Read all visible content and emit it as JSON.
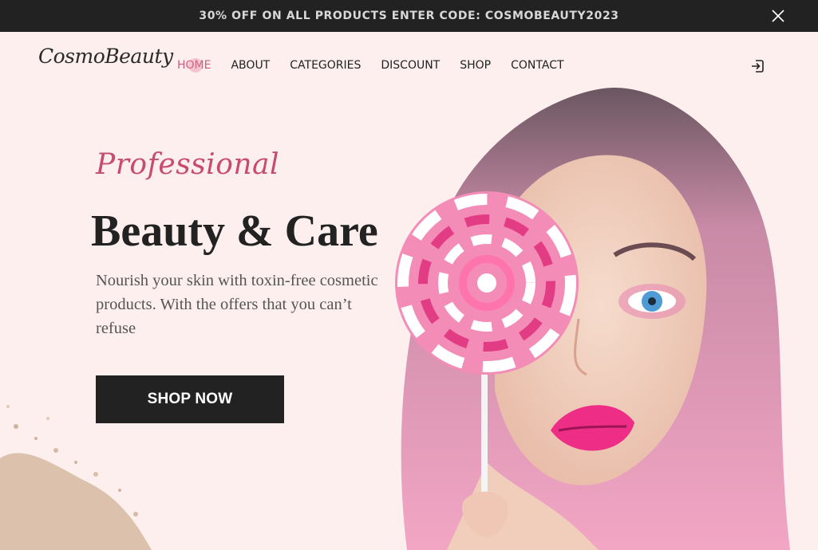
{
  "promo": {
    "text": "30% OFF ON ALL PRODUCTS ENTER CODE: COSMOBEAUTY2023",
    "close_icon": "close-icon"
  },
  "header": {
    "logo": "CosmoBeauty",
    "nav": [
      {
        "label": "HOME",
        "active": true
      },
      {
        "label": "ABOUT",
        "active": false
      },
      {
        "label": "CATEGORIES",
        "active": false
      },
      {
        "label": "DISCOUNT",
        "active": false
      },
      {
        "label": "SHOP",
        "active": false
      },
      {
        "label": "CONTACT",
        "active": false
      }
    ],
    "login_icon": "login-icon"
  },
  "hero": {
    "kicker": "Professional",
    "title": "Beauty & Care",
    "description": "Nourish your skin with toxin-free cosmetic products. With the offers that you can’t refuse",
    "cta": "SHOP NOW"
  },
  "colors": {
    "background": "#fcefee",
    "accent": "#c94a6f",
    "dark": "#222222"
  }
}
